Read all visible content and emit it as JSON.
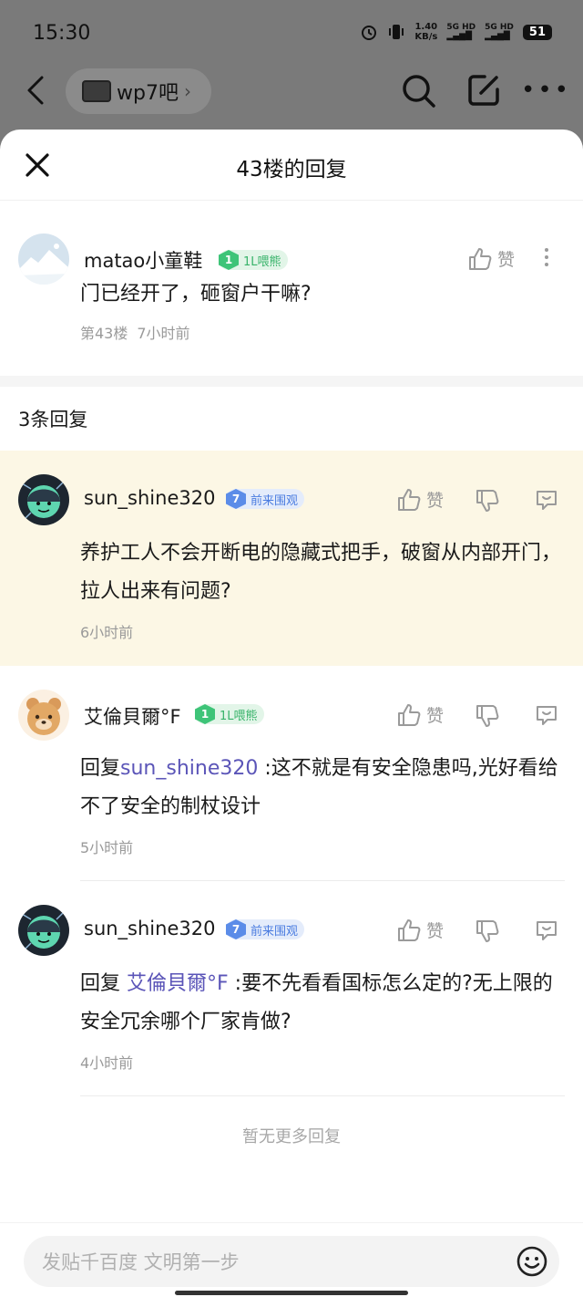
{
  "status_bar": {
    "time": "15:30",
    "net_speed_value": "1.40",
    "net_speed_unit": "KB/s",
    "signal_1": "5G HD",
    "signal_2": "5G HD",
    "battery": "51"
  },
  "background_nav": {
    "forum_name": "wp7吧"
  },
  "sheet": {
    "title": "43楼的回复"
  },
  "main_post": {
    "username": "matao小童鞋",
    "level_num": "1",
    "level_title": "1L喂熊",
    "like_label": "赞",
    "content": "门已经开了，砸窗户干嘛?",
    "floor": "第43楼",
    "time": "7小时前"
  },
  "replies_header": "3条回复",
  "replies": [
    {
      "username": "sun_shine320",
      "level_num": "7",
      "level_title": "前来围观",
      "like_label": "赞",
      "content": "养护工人不会开断电的隐藏式把手，破窗从内部开门，拉人出来有问题?",
      "time": "6小时前"
    },
    {
      "username": "艾倫貝爾°F",
      "level_num": "1",
      "level_title": "1L喂熊",
      "like_label": "赞",
      "reply_prefix": "回复",
      "mention": "sun_shine320",
      "content": " :这不就是有安全隐患吗,光好看给不了安全的制杖设计",
      "time": "5小时前"
    },
    {
      "username": "sun_shine320",
      "level_num": "7",
      "level_title": "前来围观",
      "like_label": "赞",
      "reply_prefix": "回复",
      "mention": " 艾倫貝爾°F",
      "content": " :要不先看看国标怎么定的?无上限的安全冗余哪个厂家肯做?",
      "time": "4小时前"
    }
  ],
  "no_more_text": "暂无更多回复",
  "input": {
    "placeholder": "发贴千百度 文明第一步"
  },
  "icons": {
    "back": "chevron-left-icon",
    "search": "search-icon",
    "edit": "edit-icon",
    "more": "more-icon",
    "close": "close-icon",
    "like": "thumbs-up-icon",
    "dislike": "thumbs-down-icon",
    "reply": "reply-bubble-icon",
    "emoji": "emoji-icon"
  },
  "colors": {
    "highlight_bg": "#fcf7e5",
    "mention": "#5b55b8",
    "badge_green": "#3ec478",
    "badge_blue": "#5b8ce8"
  }
}
